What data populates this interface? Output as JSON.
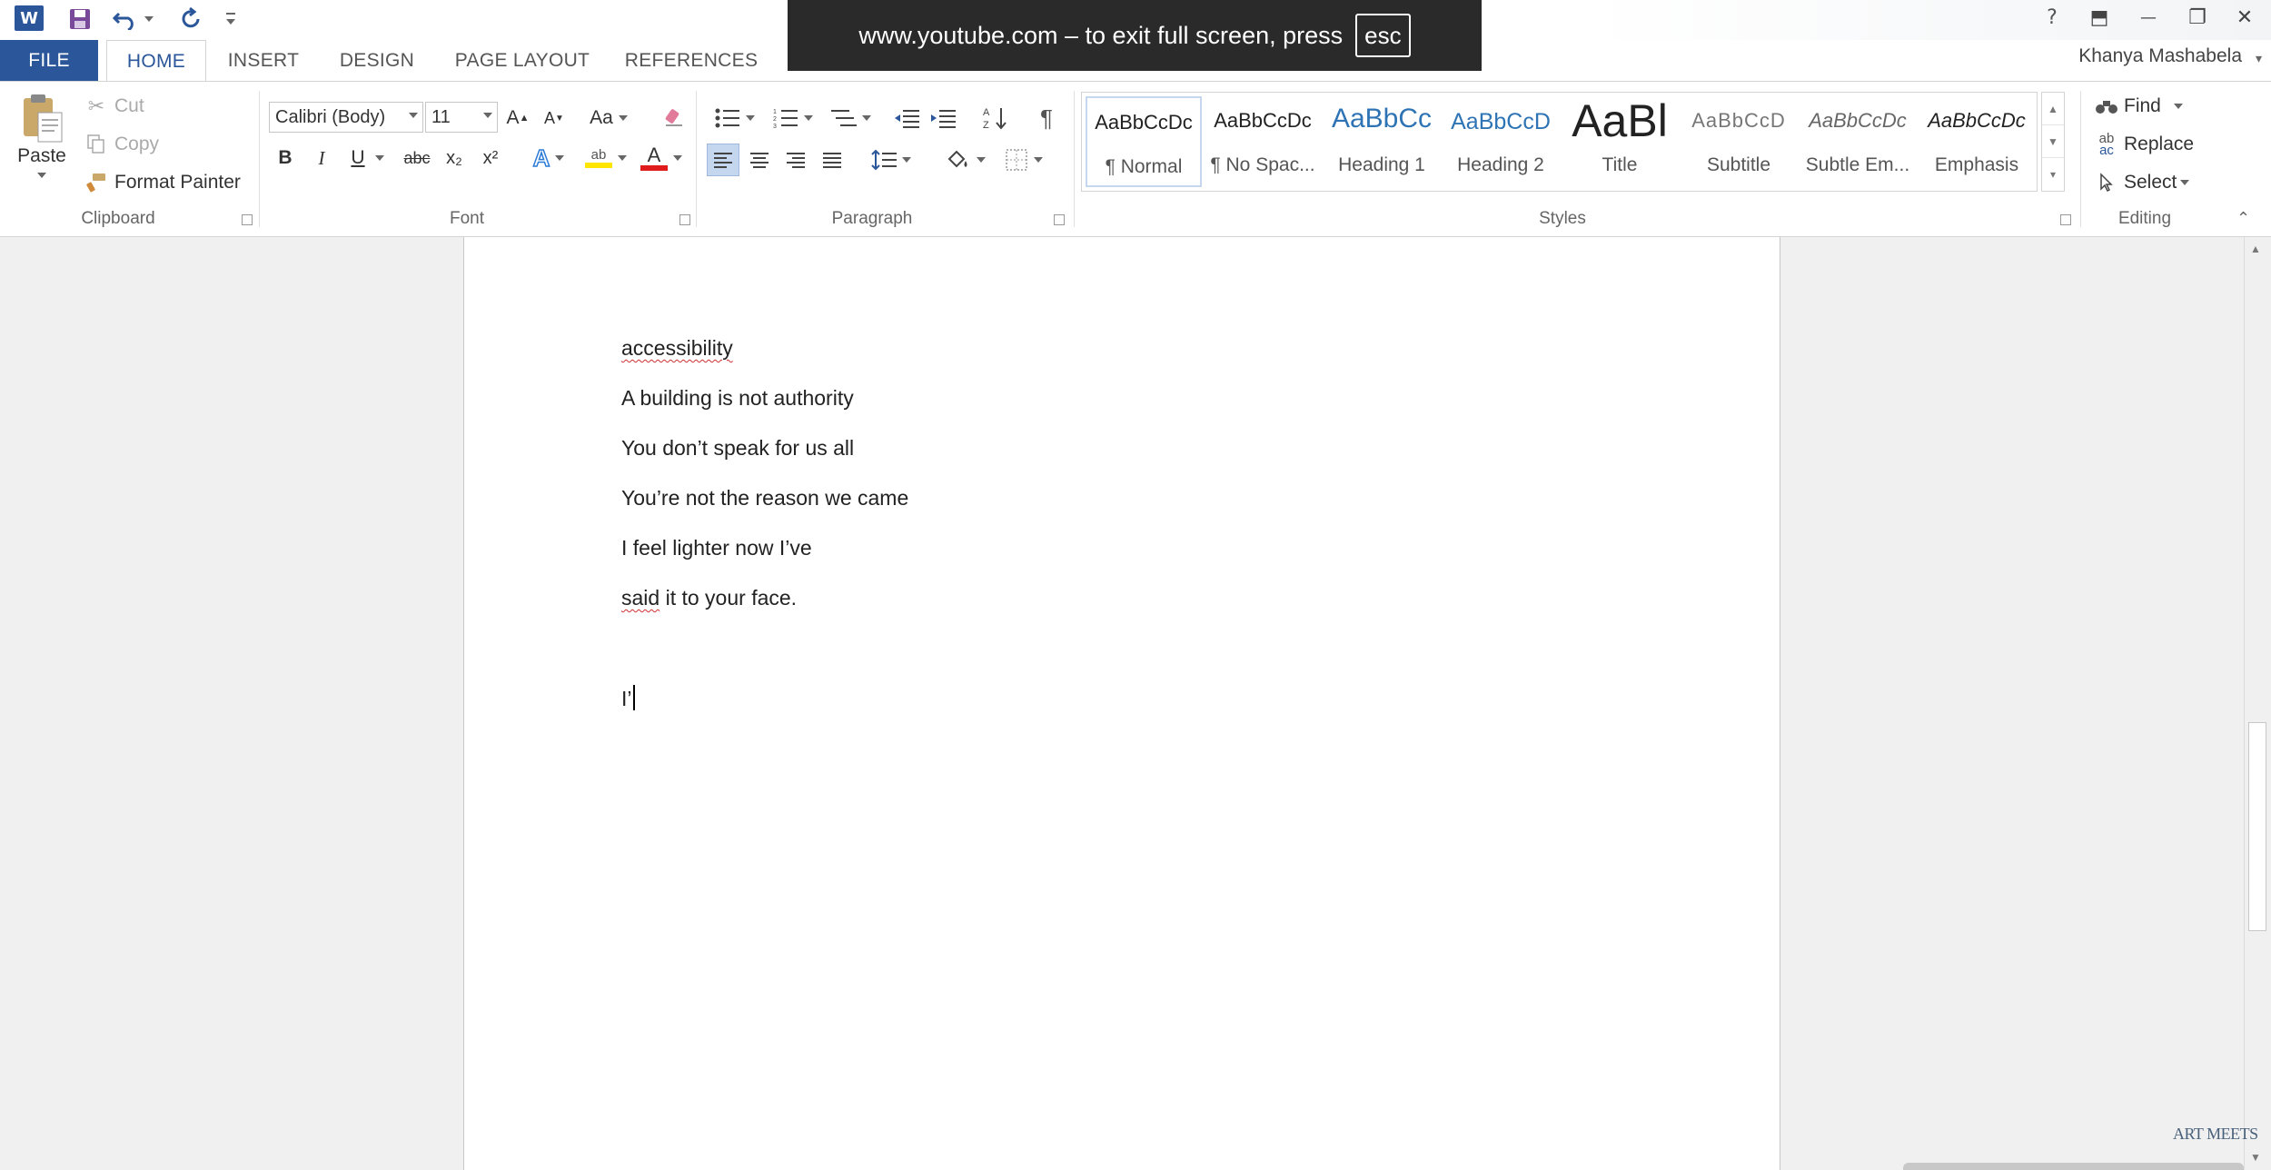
{
  "app": {
    "title_icon": "W"
  },
  "fullscreen_notice": {
    "text": "www.youtube.com – to exit full screen, press",
    "key": "esc"
  },
  "window_controls": {
    "help": "?",
    "ribbon_display": "⬒",
    "minimize": "—",
    "restore": "❐",
    "close": "✕"
  },
  "tabs": [
    {
      "label": "FILE"
    },
    {
      "label": "HOME"
    },
    {
      "label": "INSERT"
    },
    {
      "label": "DESIGN"
    },
    {
      "label": "PAGE LAYOUT"
    },
    {
      "label": "REFERENCES"
    }
  ],
  "account": {
    "name": "Khanya Mashabela"
  },
  "clipboard": {
    "paste": "Paste",
    "cut": "Cut",
    "copy": "Copy",
    "format_painter": "Format Painter",
    "group_label": "Clipboard"
  },
  "font": {
    "name": "Calibri (Body)",
    "size": "11",
    "group_label": "Font",
    "bold": "B",
    "italic": "I",
    "underline": "U",
    "strikethrough": "abc",
    "subscript": "x₂",
    "superscript": "x²",
    "change_case": "Aa",
    "grow": "A",
    "shrink": "A"
  },
  "paragraph": {
    "group_label": "Paragraph",
    "show_marks": "¶"
  },
  "styles": {
    "group_label": "Styles",
    "items": [
      {
        "preview": "AaBbCcDc",
        "name": "¶ Normal"
      },
      {
        "preview": "AaBbCcDc",
        "name": "¶ No Spac..."
      },
      {
        "preview": "AaBbCc",
        "name": "Heading 1"
      },
      {
        "preview": "AaBbCcD",
        "name": "Heading 2"
      },
      {
        "preview": "AaBl",
        "name": "Title"
      },
      {
        "preview": "AaBbCcD",
        "name": "Subtitle"
      },
      {
        "preview": "AaBbCcDc",
        "name": "Subtle Em..."
      },
      {
        "preview": "AaBbCcDc",
        "name": "Emphasis"
      }
    ]
  },
  "editing": {
    "find": "Find",
    "replace": "Replace",
    "select": "Select",
    "group_label": "Editing"
  },
  "document": {
    "lines": [
      "accessibility",
      "A building is not authority",
      "You don’t speak for us all",
      "You’re not the reason we came",
      "I feel lighter now I’ve",
      "said",
      " it to your face."
    ],
    "current_line": "I’"
  },
  "watermark": "ART MEETS"
}
